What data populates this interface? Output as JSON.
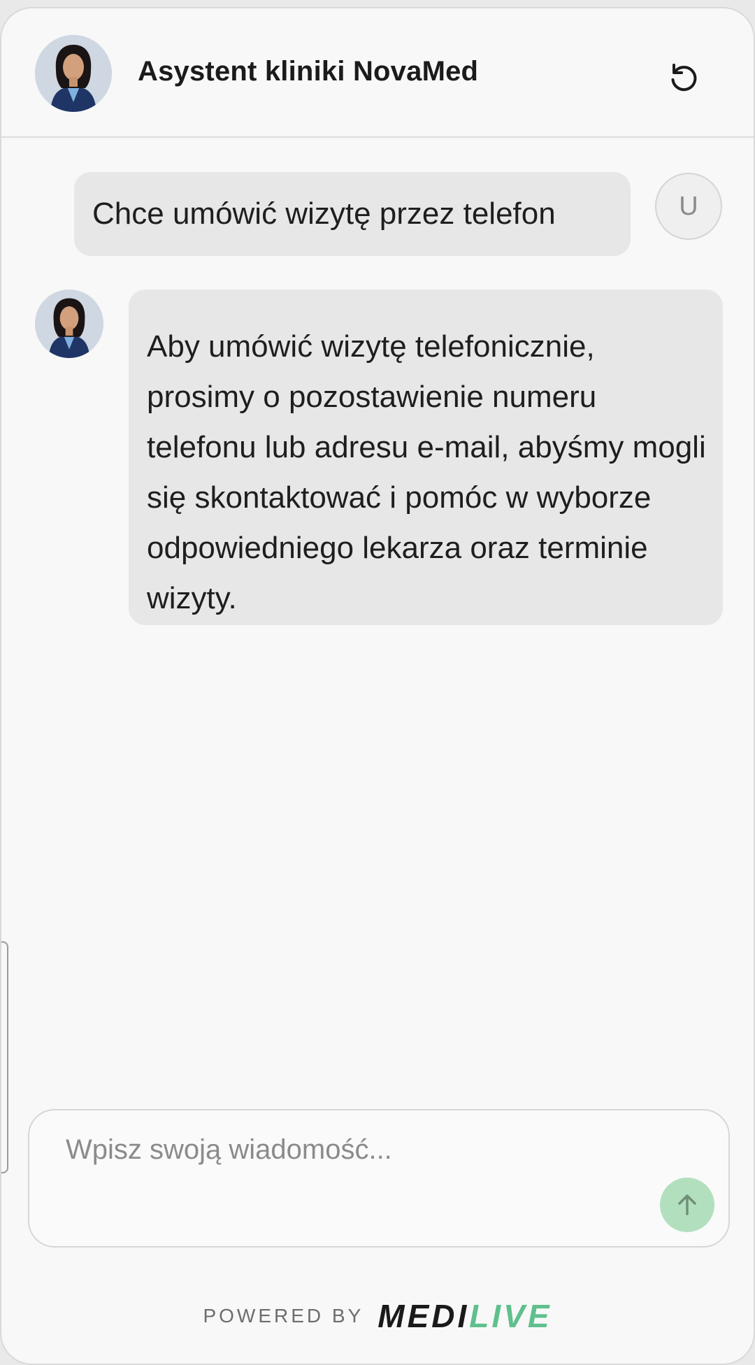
{
  "header": {
    "title": "Asystent kliniki NovaMed",
    "avatar_icon": "assistant-avatar",
    "reset_icon": "refresh-icon"
  },
  "messages": [
    {
      "role": "user",
      "avatar_letter": "U",
      "text": "Chce umówić wizytę przez telefon"
    },
    {
      "role": "assistant",
      "text": "Aby umówić wizytę telefonicznie, prosimy o pozostawienie numeru telefonu lub adresu e-mail, abyśmy mogli się skontaktować i pomóc w wyborze odpowiedniego lekarza oraz terminie wizyty."
    }
  ],
  "composer": {
    "placeholder": "Wpisz swoją wiadomość...",
    "value": "",
    "send_icon": "arrow-up-icon"
  },
  "footer": {
    "powered_label": "POWERED BY",
    "logo_part1": "MEDI",
    "logo_part2": "LIVE"
  },
  "colors": {
    "accent": "#5fc08d",
    "send_button": "#b2e0be",
    "bubble": "#e7e7e7",
    "background": "#f8f8f8"
  }
}
